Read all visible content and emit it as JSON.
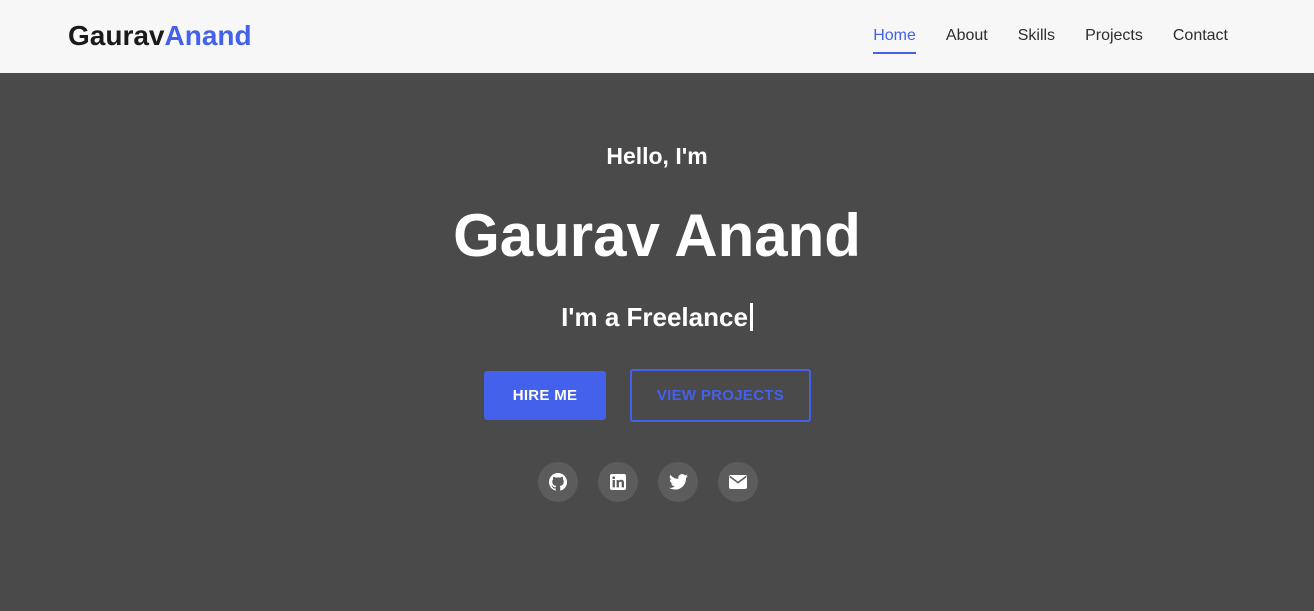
{
  "header": {
    "logo_first": "Gaurav",
    "logo_second": "Anand",
    "nav": [
      {
        "label": "Home",
        "active": true
      },
      {
        "label": "About"
      },
      {
        "label": "Skills"
      },
      {
        "label": "Projects"
      },
      {
        "label": "Contact"
      }
    ]
  },
  "hero": {
    "greeting": "Hello, I'm",
    "name": "Gaurav Anand",
    "role": "I'm a Freelance",
    "primary_button": "HIRE ME",
    "secondary_button": "VIEW PROJECTS",
    "socials": [
      {
        "icon": "github-icon"
      },
      {
        "icon": "linkedin-icon"
      },
      {
        "icon": "twitter-icon"
      },
      {
        "icon": "email-icon"
      }
    ]
  },
  "colors": {
    "accent": "#4461ec",
    "header_bg": "#f7f7f7",
    "hero_bg": "#4a4a4a",
    "social_bg": "#5c5c5c"
  }
}
